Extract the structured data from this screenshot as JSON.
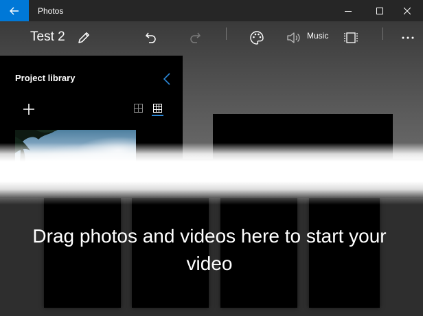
{
  "window": {
    "app_title": "Photos"
  },
  "toolbar": {
    "project_title": "Test 2",
    "music_label": "Music"
  },
  "library": {
    "title": "Project library"
  },
  "storyboard": {
    "message": "Drag photos and videos here to start your video"
  },
  "colors": {
    "accent": "#0078d7",
    "underline": "#2b88d8"
  }
}
